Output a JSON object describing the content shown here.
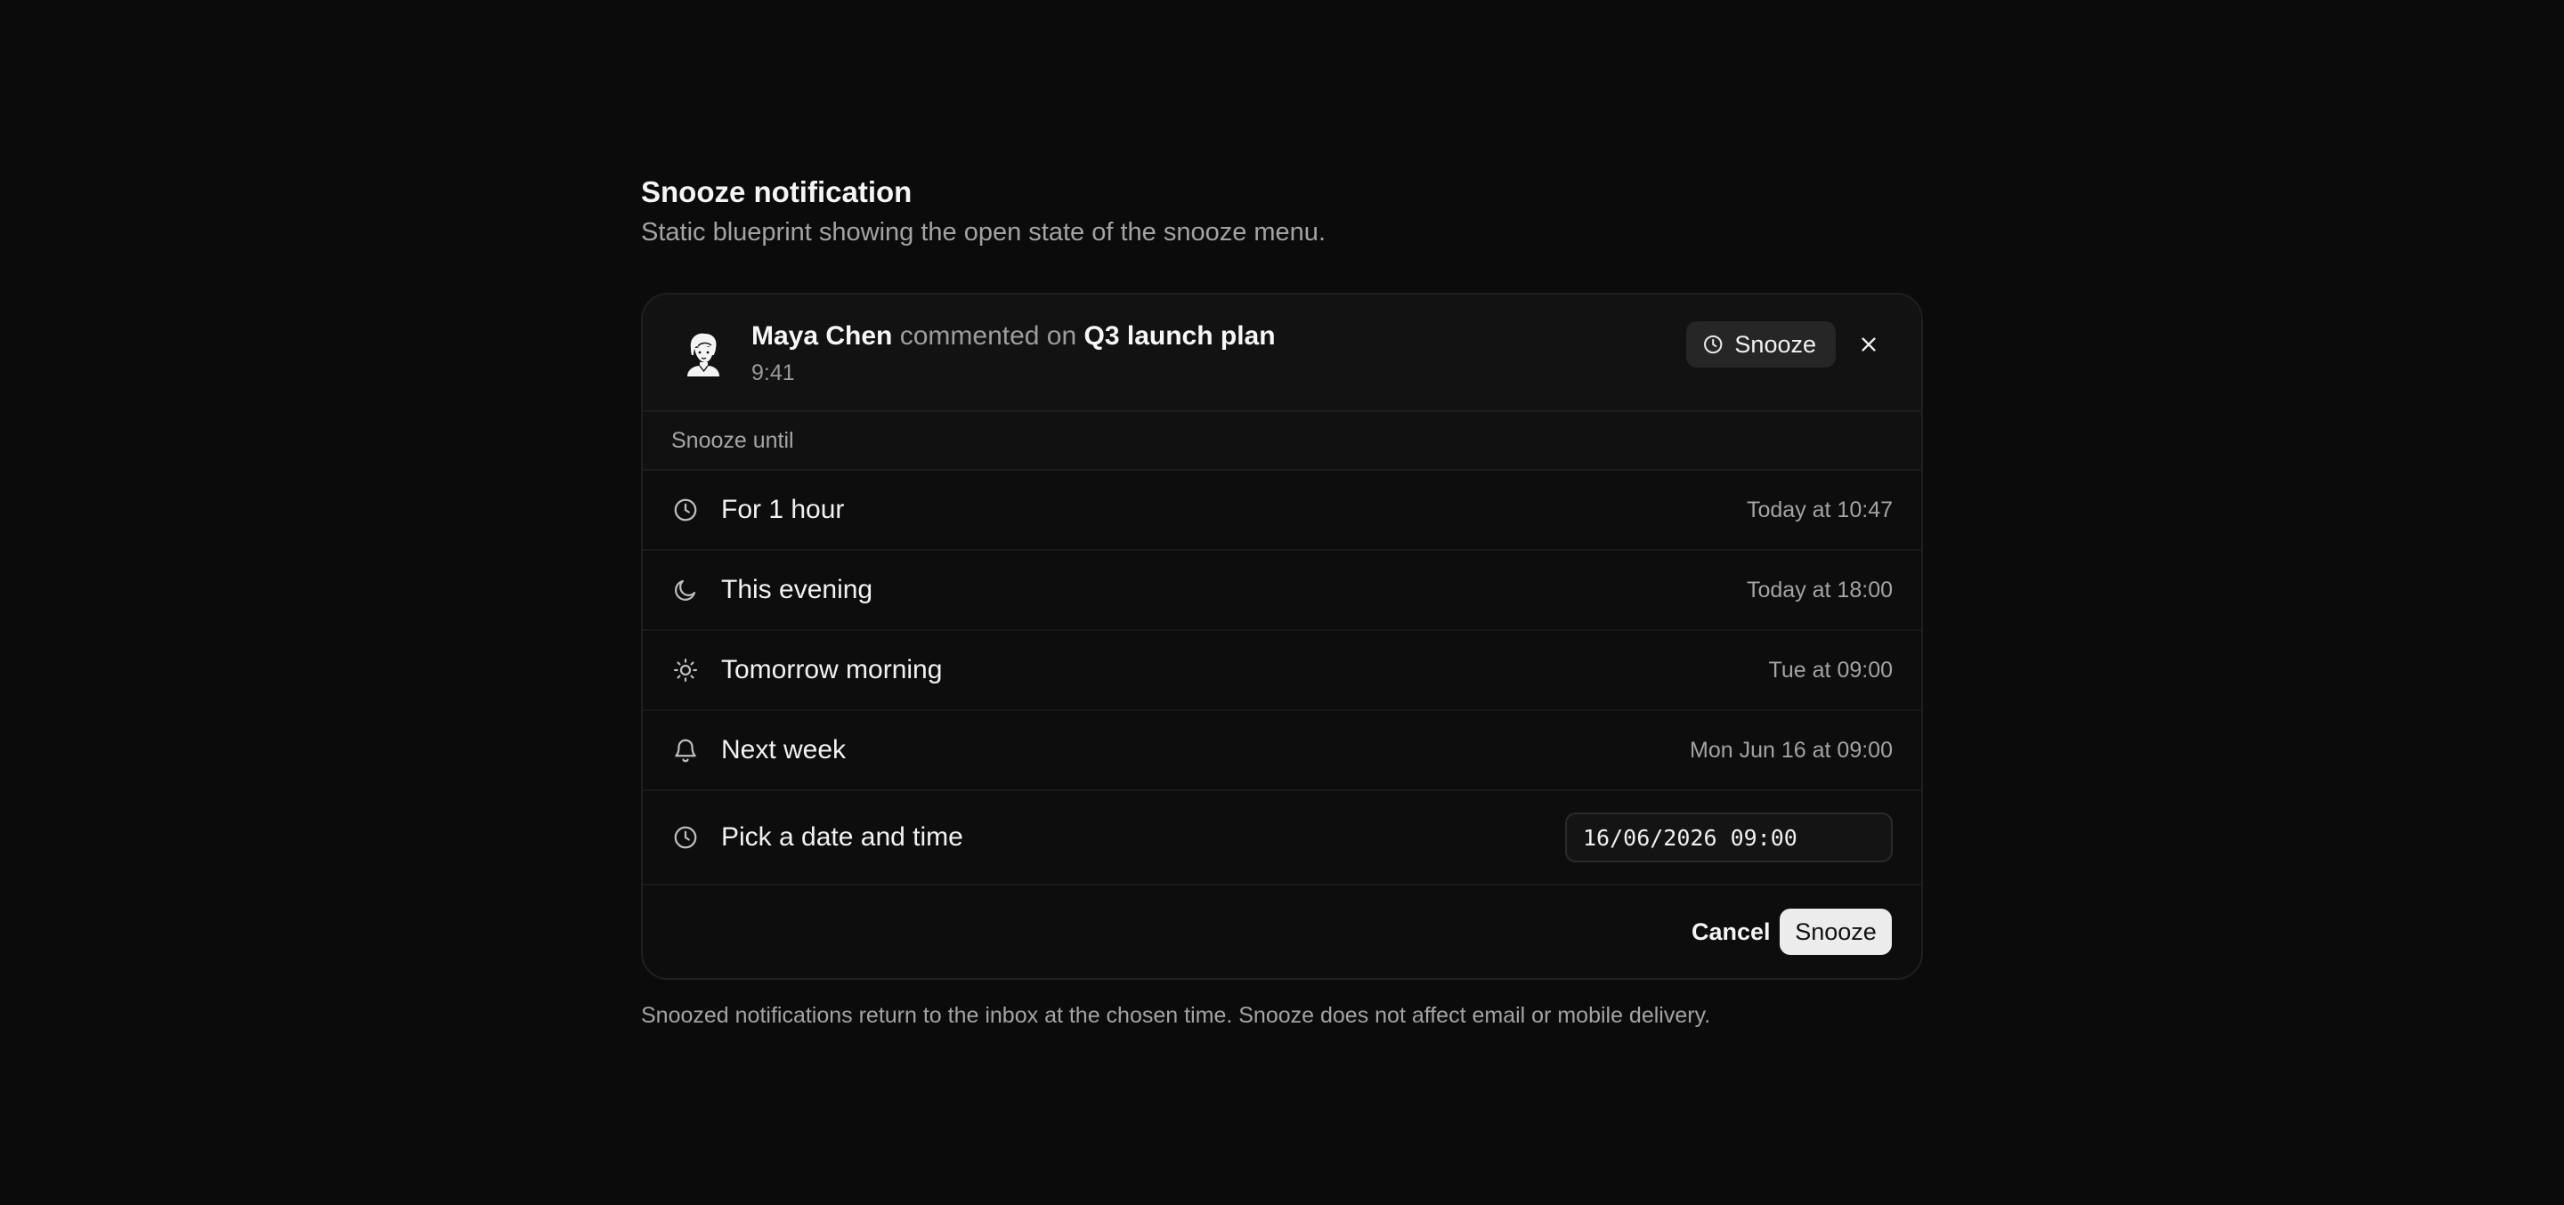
{
  "page": {
    "title": "Snooze notification",
    "subtitle": "Static blueprint showing the open state of the snooze menu."
  },
  "notification": {
    "actor": "Maya Chen",
    "action": "commented on",
    "target": "Q3 launch plan",
    "time": "9:41",
    "snooze_label": "Snooze",
    "avatar_icon": "person-avatar-icon"
  },
  "menu": {
    "section_label": "Snooze until",
    "options": [
      {
        "label": "For 1 hour",
        "time": "Today at 10:47",
        "icon": "clock-icon"
      },
      {
        "label": "This evening",
        "time": "Today at 18:00",
        "icon": "moon-icon"
      },
      {
        "label": "Tomorrow morning",
        "time": "Tue at 09:00",
        "icon": "sun-icon"
      },
      {
        "label": "Next week",
        "time": "Mon Jun 16 at 09:00",
        "icon": "bell-icon"
      }
    ],
    "custom": {
      "label": "Pick a date and time",
      "value": "16/06/2026 09:00",
      "icon": "clock-icon"
    }
  },
  "actions": {
    "cancel_label": "Cancel",
    "confirm_label": "Snooze"
  },
  "footnote": "Snoozed notifications return to the inbox at the chosen time. Snooze does not affect email or mobile delivery.",
  "colors": {
    "background": "#0b0b0b",
    "card": "#0d0d0d",
    "primary_button": "#ececec"
  }
}
